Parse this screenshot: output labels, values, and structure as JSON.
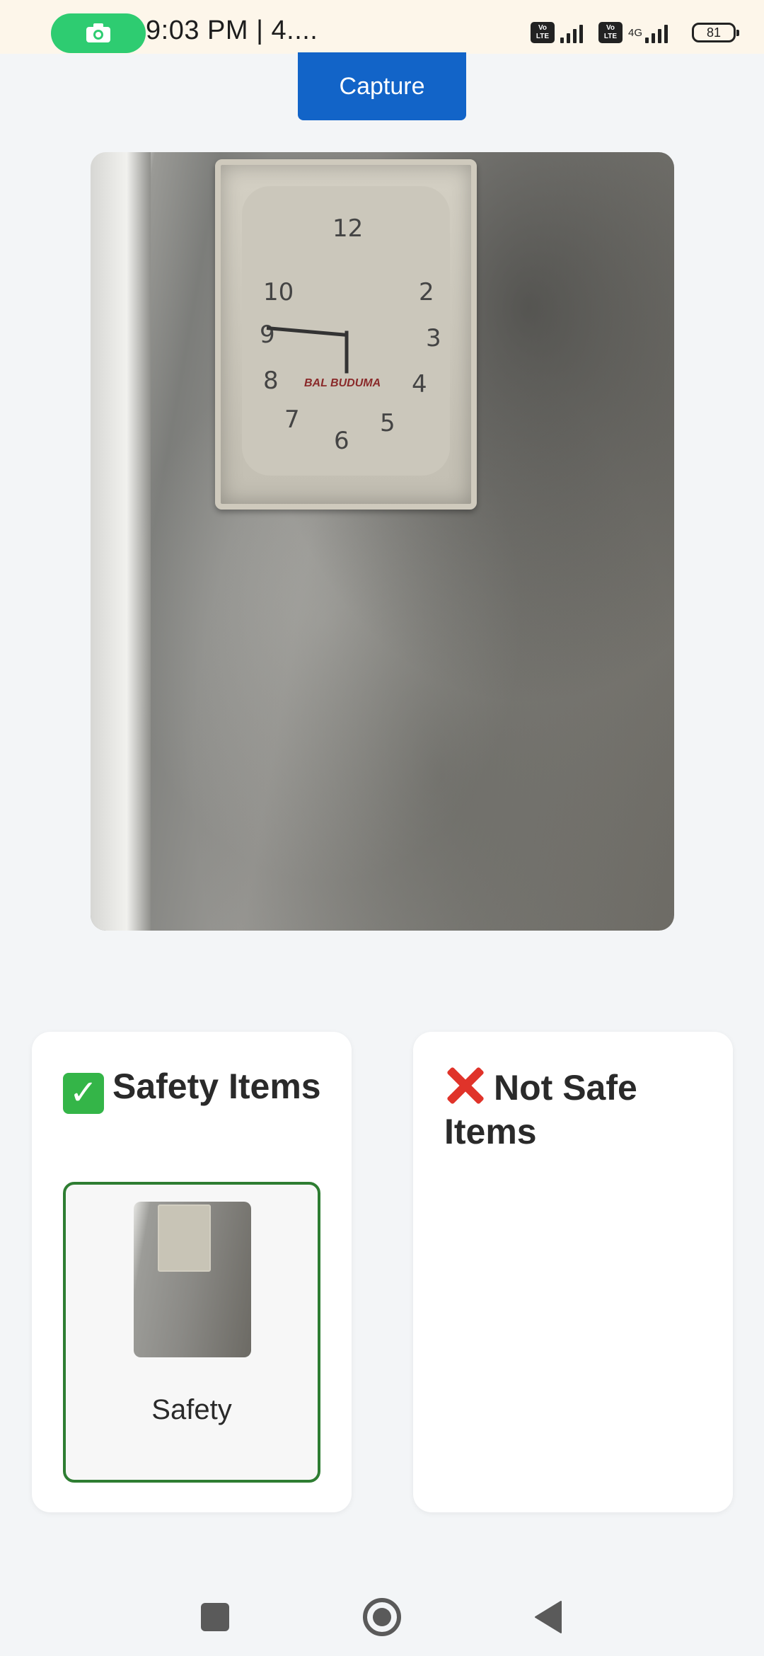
{
  "status_bar": {
    "time": "9:03 PM | 4....",
    "volte1": "Vo\nLTE",
    "volte2": "Vo\nLTE",
    "network": "4G",
    "battery": "81"
  },
  "capture_button": {
    "label": "Capture"
  },
  "preview": {
    "clock_numbers": [
      "12",
      "2",
      "3",
      "4",
      "5",
      "6",
      "7",
      "8",
      "9",
      "10"
    ],
    "clock_brand": "BAL BUDUMA"
  },
  "safe_card": {
    "title": "Safety Items",
    "emoji": "✅",
    "items": [
      {
        "label": "Safety"
      }
    ]
  },
  "unsafe_card": {
    "title": "Not Safe Items",
    "emoji": "❌",
    "items": []
  },
  "colors": {
    "accent": "#1264c8",
    "safe_border": "#2e7d32",
    "status_pill": "#2ecc71",
    "status_bg": "#fdf6ea",
    "page_bg": "#f3f5f7"
  },
  "icons": {
    "status_pill": "camera-icon",
    "nav_recents": "square-icon",
    "nav_home": "circle-home-icon",
    "nav_back": "triangle-back-icon"
  }
}
